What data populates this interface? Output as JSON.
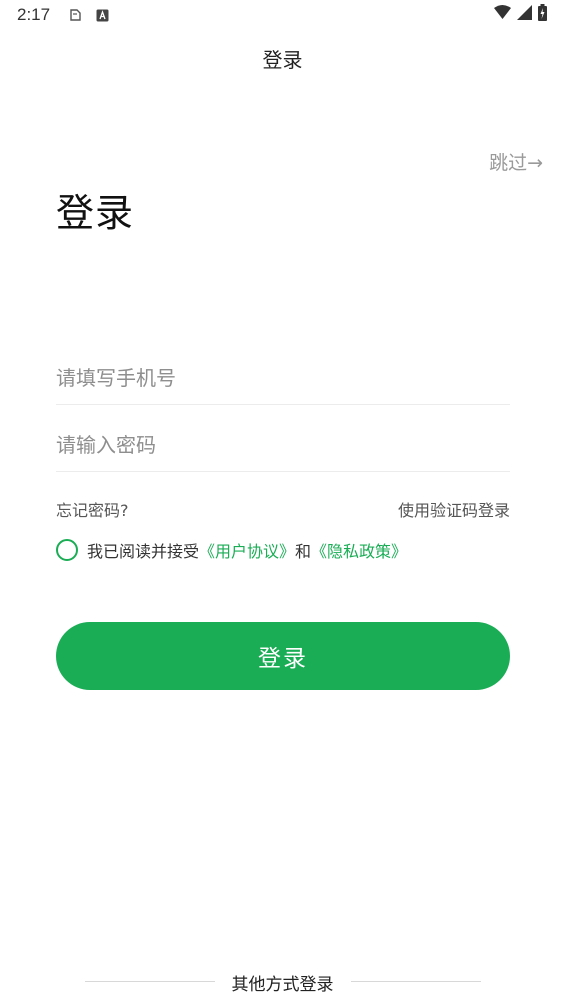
{
  "status_bar": {
    "time": "2:17"
  },
  "header": {
    "title": "登录"
  },
  "skip": {
    "label": "跳过→"
  },
  "page": {
    "title": "登录"
  },
  "form": {
    "phone_placeholder": "请填写手机号",
    "password_placeholder": "请输入密码",
    "forgot_label": "忘记密码?",
    "sms_login_label": "使用验证码登录"
  },
  "agreement": {
    "prefix": "我已阅读并接受",
    "user_agreement": "《用户协议》",
    "conjunction": "和",
    "privacy_policy": "《隐私政策》"
  },
  "login_button": {
    "label": "登录"
  },
  "other_login": {
    "label": "其他方式登录"
  },
  "colors": {
    "accent": "#1aad55",
    "muted_text": "#9a9a9a"
  },
  "icons": {
    "status_left": [
      "clipboard-icon",
      "a-badge-icon"
    ],
    "status_right": [
      "wifi-icon",
      "signal-icon",
      "battery-charging-icon"
    ]
  }
}
